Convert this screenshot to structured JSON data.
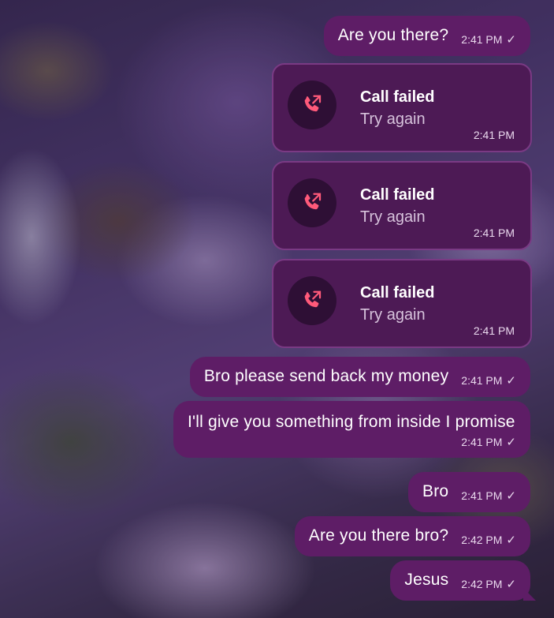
{
  "messages": [
    {
      "type": "text",
      "text": "Are you there?",
      "time": "2:41 PM",
      "status": "✓"
    },
    {
      "type": "call",
      "title": "Call failed",
      "subtitle": "Try again",
      "time": "2:41 PM"
    },
    {
      "type": "call",
      "title": "Call failed",
      "subtitle": "Try again",
      "time": "2:41 PM"
    },
    {
      "type": "call",
      "title": "Call failed",
      "subtitle": "Try again",
      "time": "2:41 PM"
    },
    {
      "type": "text",
      "text": "Bro please send back my money",
      "time": "2:41 PM",
      "status": "✓"
    },
    {
      "type": "text",
      "text": "I'll give you something from inside I promise",
      "time": "2:41 PM",
      "status": "✓"
    },
    {
      "type": "text",
      "text": "Bro",
      "time": "2:41 PM",
      "status": "✓"
    },
    {
      "type": "text",
      "text": "Are you there bro?",
      "time": "2:42 PM",
      "status": "✓"
    },
    {
      "type": "text",
      "text": "Jesus",
      "time": "2:42 PM",
      "status": "✓"
    }
  ],
  "icons": {
    "call_failed": "phone-outgoing-icon"
  },
  "colors": {
    "bubble": "#5e1d66",
    "call_bubble": "#4d1a55",
    "call_icon_accent": "#ff5a7a"
  }
}
